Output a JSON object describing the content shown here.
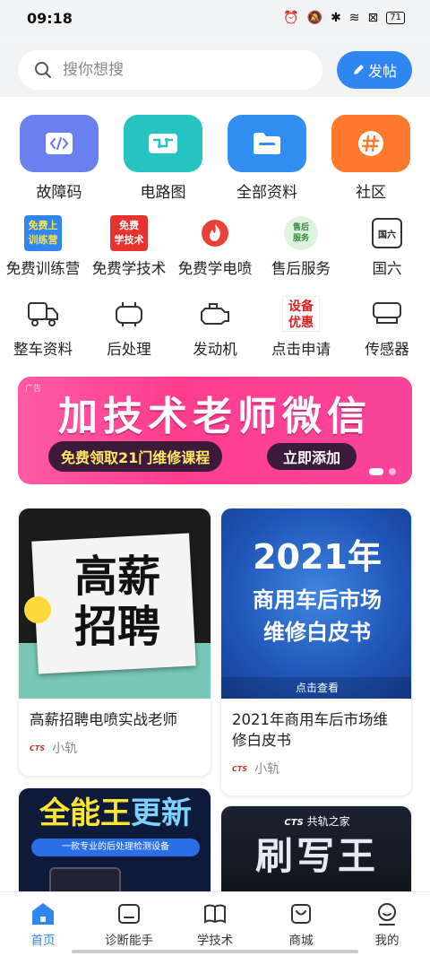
{
  "status": {
    "time": "09:18",
    "battery": "71"
  },
  "search": {
    "placeholder": "搜你想搜",
    "post_label": "发帖"
  },
  "big_icons": [
    {
      "label": "故障码",
      "icon": "code-icon",
      "color": "#6a7ff0"
    },
    {
      "label": "电路图",
      "icon": "circuit-icon",
      "color": "#25c4c3"
    },
    {
      "label": "全部资料",
      "icon": "folder-icon",
      "color": "#2f8ef0"
    },
    {
      "label": "社区",
      "icon": "hash-icon",
      "color": "#ff7a2f"
    }
  ],
  "row2": [
    {
      "label": "免费训练营",
      "badge": [
        "免费上",
        "训练营"
      ]
    },
    {
      "label": "免费学技术",
      "badge": [
        "免费",
        "学技术"
      ]
    },
    {
      "label": "免费学电喷",
      "icon": "flame-icon"
    },
    {
      "label": "售后服务",
      "badge": [
        "售后",
        "服务"
      ]
    },
    {
      "label": "国六",
      "badge": [
        "国六"
      ]
    }
  ],
  "row3": [
    {
      "label": "整车资料",
      "icon": "truck-icon"
    },
    {
      "label": "后处理",
      "icon": "aftertreatment-icon"
    },
    {
      "label": "发动机",
      "icon": "engine-icon"
    },
    {
      "label": "点击申请",
      "badge": [
        "设备",
        "优惠"
      ]
    },
    {
      "label": "传感器",
      "icon": "sensor-icon"
    }
  ],
  "banner": {
    "ad": "广告",
    "headline": "加技术老师微信",
    "pill": "免费领取21门维修课程",
    "button": "立即添加"
  },
  "cards": [
    {
      "image_text": [
        "高薪",
        "招聘"
      ],
      "title": "高薪招聘电喷实战老师",
      "author": "小轨",
      "logo": "CTS"
    },
    {
      "image_text": [
        "2021年",
        "商用车后市场",
        "维修白皮书",
        "点击查看"
      ],
      "title": "2021年商用车后市场维修白皮书",
      "author": "小轨",
      "logo": "CTS"
    },
    {
      "image_text": [
        "全能王",
        "更新",
        "一款专业的后处理检测设备"
      ]
    },
    {
      "image_text": [
        "共轨之家",
        "刷写王"
      ],
      "logo": "CTS"
    }
  ],
  "tabs": [
    {
      "label": "首页",
      "icon": "home-icon"
    },
    {
      "label": "诊断能手",
      "icon": "diagnose-icon"
    },
    {
      "label": "学技术",
      "icon": "book-icon"
    },
    {
      "label": "商城",
      "icon": "shop-bag-icon"
    },
    {
      "label": "我的",
      "icon": "profile-icon"
    }
  ],
  "colors": {
    "accent": "#2f86f0",
    "banner": "#ff3d8e"
  }
}
